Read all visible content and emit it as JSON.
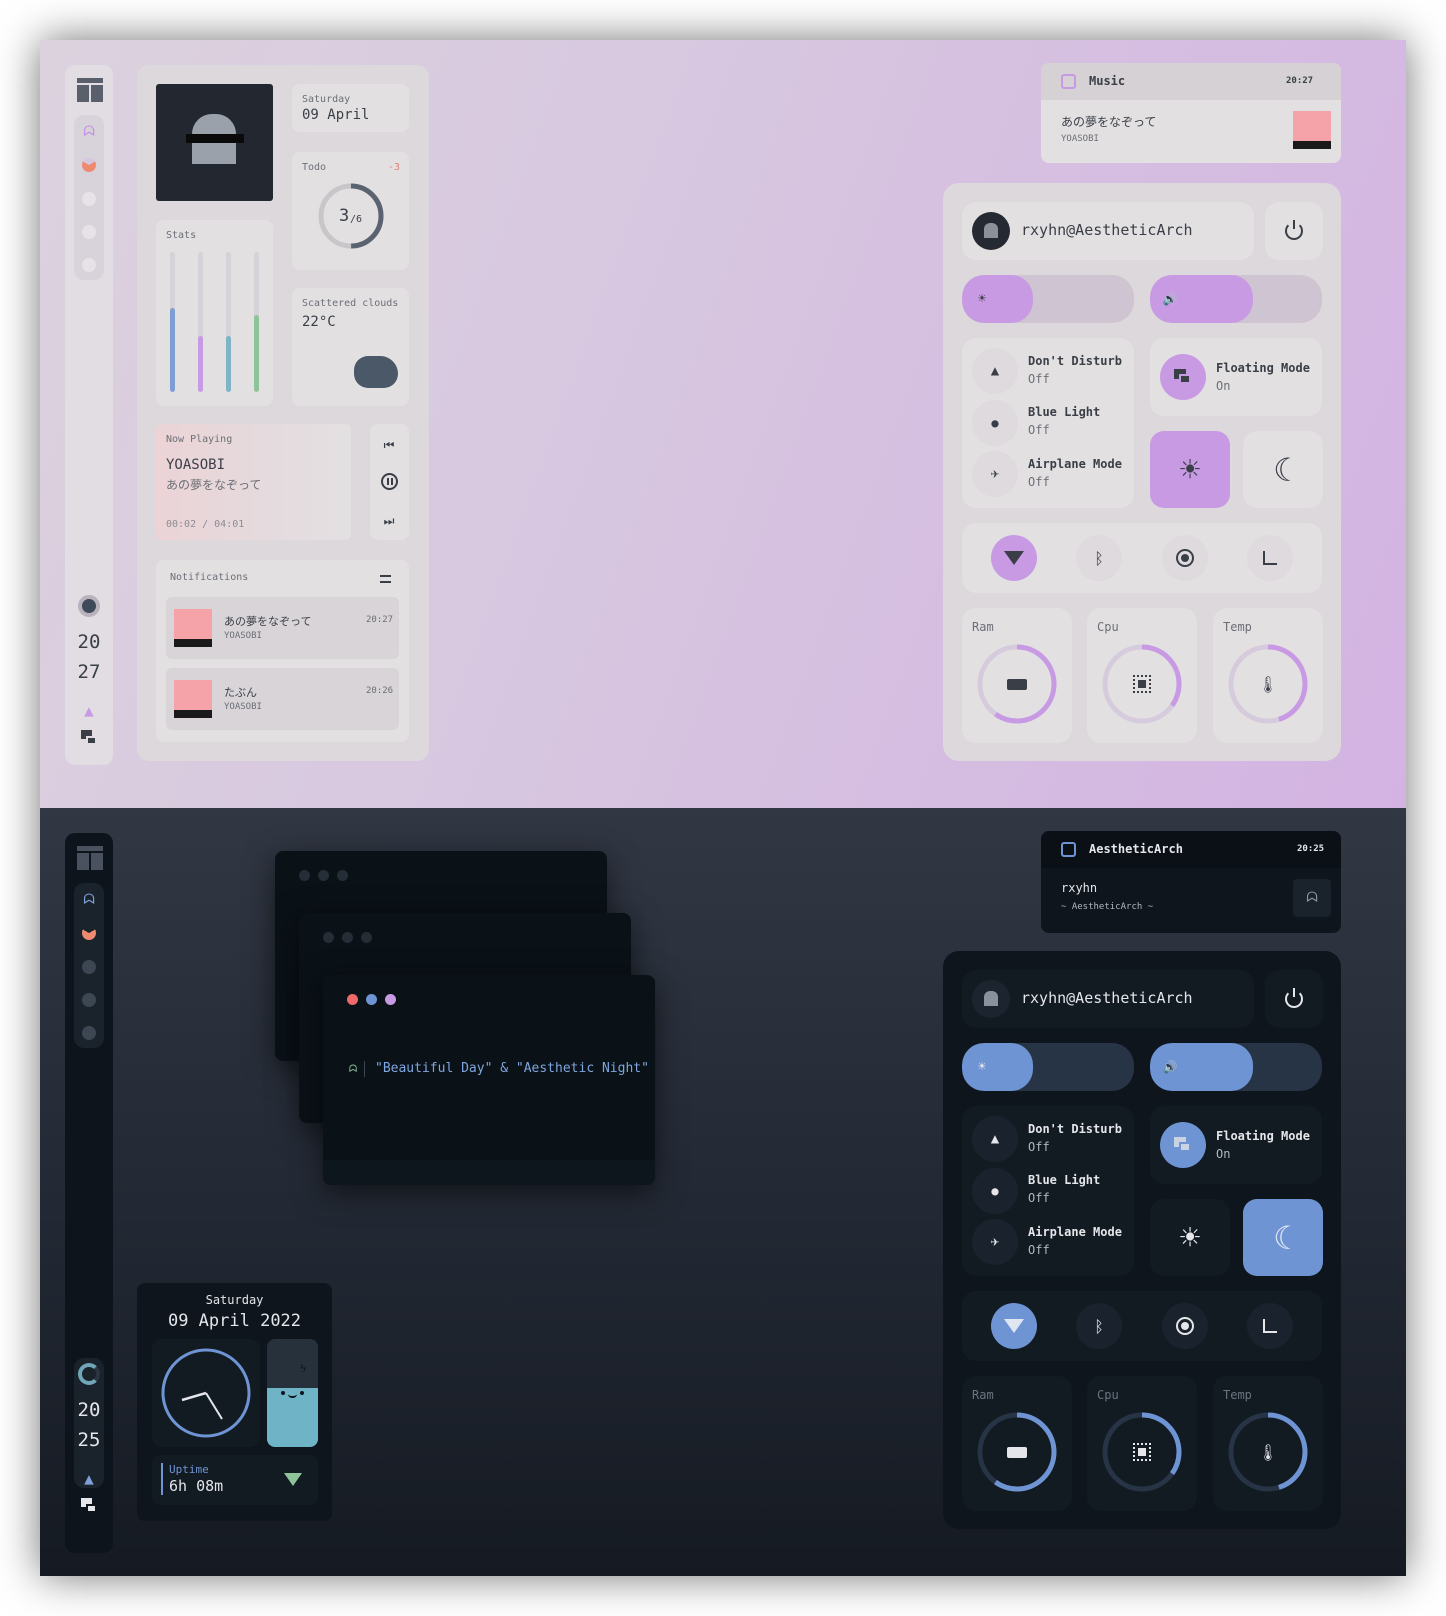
{
  "light": {
    "bar": {
      "hour": "20",
      "minute": "27"
    },
    "dashboard": {
      "date": {
        "day": "Saturday",
        "date": "09 April"
      },
      "todo": {
        "label": "Todo",
        "badge": "-3",
        "done": "3",
        "total": "/6",
        "fraction": 0.5
      },
      "stats": {
        "label": "Stats",
        "levels": [
          0.6,
          0.4,
          0.4,
          0.55
        ]
      },
      "weather": {
        "condition": "Scattered clouds",
        "temp": "22°C"
      },
      "now_playing": {
        "label": "Now Playing",
        "artist": "YOASOBI",
        "title": "あの夢をなぞって",
        "time": "00:02 / 04:01"
      },
      "notifications": {
        "label": "Notifications",
        "items": [
          {
            "title": "あの夢をなぞって",
            "sub": "YOASOBI",
            "time": "20:27"
          },
          {
            "title": "たぶん",
            "sub": "YOASOBI",
            "time": "20:26"
          }
        ]
      }
    },
    "popup": {
      "app": "Music",
      "time": "20:27",
      "title": "あの夢をなぞって",
      "sub": "YOASOBI"
    },
    "qs": {
      "user": "rxyhn@AestheticArch",
      "brightness": 0.4,
      "volume": 0.6,
      "toggles": [
        {
          "name": "Don't Disturb",
          "state": "Off"
        },
        {
          "name": "Blue Light",
          "state": "Off"
        },
        {
          "name": "Airplane Mode",
          "state": "Off"
        }
      ],
      "floating": {
        "name": "Floating Mode",
        "state": "On"
      },
      "gauges": [
        {
          "label": "Ram",
          "value": 0.6
        },
        {
          "label": "Cpu",
          "value": 0.35
        },
        {
          "label": "Temp",
          "value": 0.45
        }
      ]
    }
  },
  "dark": {
    "bar": {
      "hour": "20",
      "minute": "25"
    },
    "terminal": {
      "command": "\"Beautiful Day\" & \"Aesthetic Night\""
    },
    "clock_widget": {
      "day": "Saturday",
      "date": "09 April 2022",
      "uptime_label": "Uptime",
      "uptime": "6h 08m",
      "battery": 0.55
    },
    "popup": {
      "app": "AestheticArch",
      "time": "20:25",
      "title": "rxyhn",
      "sub": "~ AestheticArch ~"
    },
    "qs": {
      "user": "rxyhn@AestheticArch",
      "brightness": 0.4,
      "volume": 0.6,
      "toggles": [
        {
          "name": "Don't Disturb",
          "state": "Off"
        },
        {
          "name": "Blue Light",
          "state": "Off"
        },
        {
          "name": "Airplane Mode",
          "state": "Off"
        }
      ],
      "floating": {
        "name": "Floating Mode",
        "state": "On"
      },
      "gauges": [
        {
          "label": "Ram",
          "value": 0.6
        },
        {
          "label": "Cpu",
          "value": 0.35
        },
        {
          "label": "Temp",
          "value": 0.45
        }
      ]
    }
  },
  "colors": {
    "accent_light": "#c89ae4",
    "accent_dark": "#6f94d4",
    "pink": "#f5a3a8",
    "text_dark": "#3a3f47"
  }
}
